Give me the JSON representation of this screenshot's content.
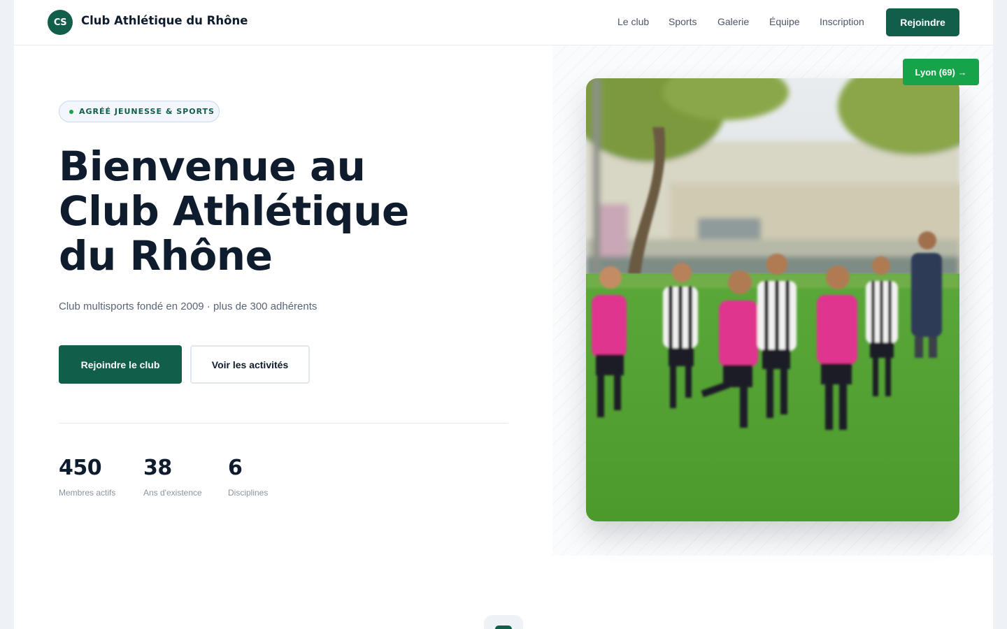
{
  "header": {
    "logo_initials": "CS",
    "site_name": "Club Athlétique du Rhône",
    "nav": [
      "Le club",
      "Sports",
      "Galerie",
      "Équipe",
      "Inscription"
    ],
    "cta": "Rejoindre"
  },
  "hero": {
    "badge": "AGRÉÉ JEUNESSE & SPORTS",
    "title_lines": [
      "Bienvenue au",
      "Club Athlétique",
      "du Rhône"
    ],
    "subtitle": "Club multisports fondé en 2009 · plus de 300 adhérents",
    "primary_button": "Rejoindre le club",
    "secondary_button": "Voir les activités",
    "location_badge": "Lyon (69) →",
    "stats": [
      {
        "value": "450",
        "label": "Membres actifs"
      },
      {
        "value": "38",
        "label": "Ans d'existence"
      },
      {
        "value": "6",
        "label": "Disciplines"
      }
    ]
  },
  "colors": {
    "brand": "#115e4b",
    "accent": "#17a34a",
    "text": "#0f1c2e"
  }
}
